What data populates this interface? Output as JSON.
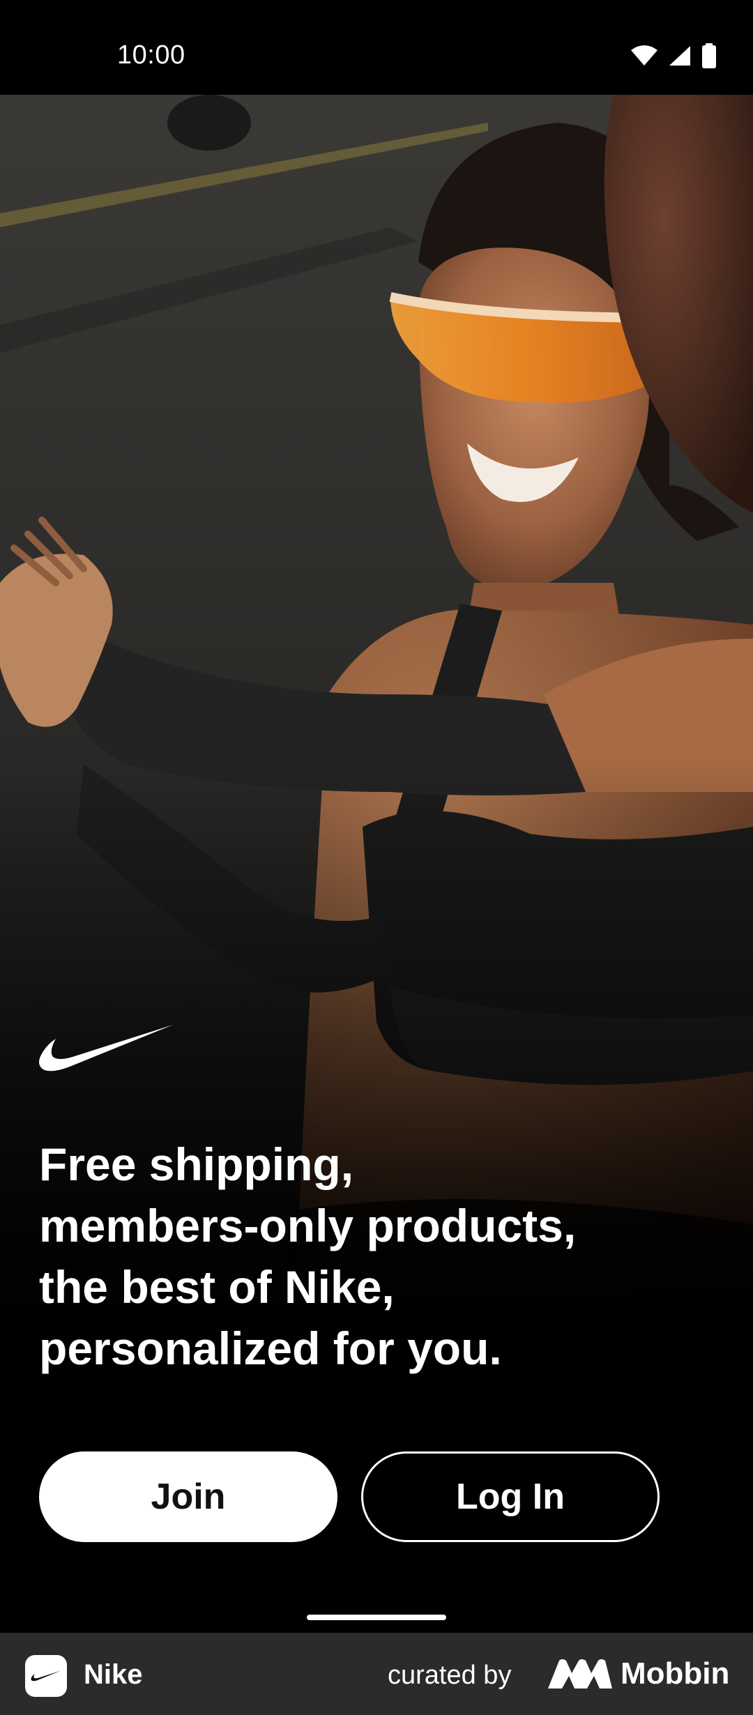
{
  "status_bar": {
    "time": "10:00",
    "icons": [
      "wifi-icon",
      "cellular-signal-icon",
      "battery-icon"
    ]
  },
  "hero": {
    "image": "photo-woman-runner-orange-sunglasses",
    "brand_logo": "nike-swoosh-icon"
  },
  "headline": {
    "lines": [
      "Free shipping,",
      "members-only products,",
      "the best of Nike,",
      "personalized for you."
    ]
  },
  "actions": {
    "join_label": "Join",
    "login_label": "Log In"
  },
  "footer": {
    "app_name": "Nike",
    "curated_label": "curated by",
    "brand_name": "Mobbin"
  },
  "colors": {
    "background": "#000000",
    "primary_button_bg": "#ffffff",
    "primary_button_text": "#111111",
    "footer_bg": "#2b2b2b",
    "sunglasses_lens": "#e8821f"
  }
}
